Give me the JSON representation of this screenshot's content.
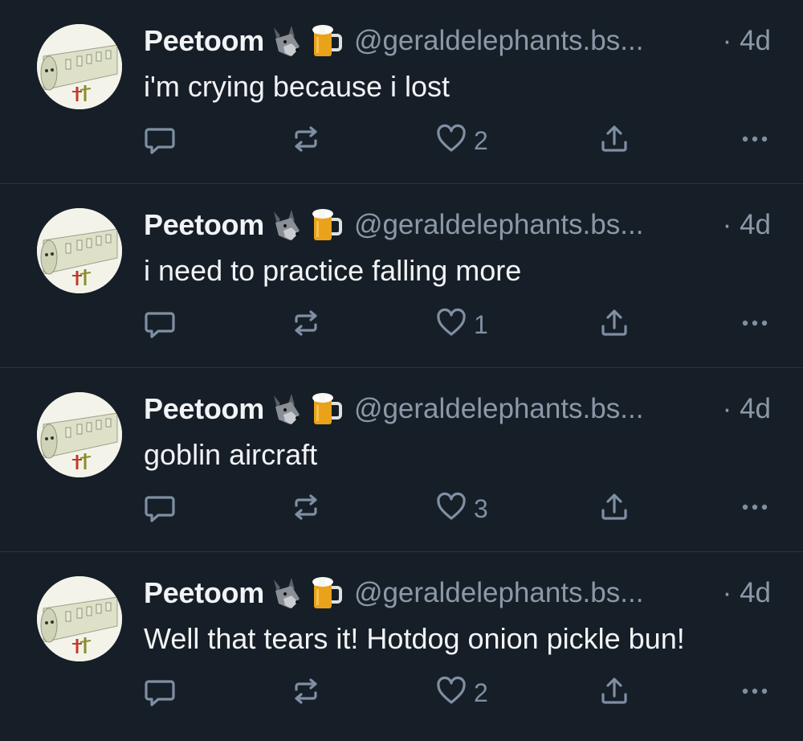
{
  "posts": [
    {
      "author": "Peetoom",
      "handle": "@geraldelephants.bs...",
      "separator": "·",
      "time": "4d",
      "text": "i'm crying because i lost",
      "likes": "2"
    },
    {
      "author": "Peetoom",
      "handle": "@geraldelephants.bs...",
      "separator": "·",
      "time": "4d",
      "text": "i need to practice falling more",
      "likes": "1"
    },
    {
      "author": "Peetoom",
      "handle": "@geraldelephants.bs...",
      "separator": "·",
      "time": "4d",
      "text": "goblin aircraft",
      "likes": "3"
    },
    {
      "author": "Peetoom",
      "handle": "@geraldelephants.bs...",
      "separator": "·",
      "time": "4d",
      "text": "Well that tears it! Hotdog onion pickle bun!",
      "likes": "2"
    }
  ],
  "icons": {
    "author_emoji_1": "wolf-face-icon",
    "author_emoji_2": "beer-mug-icon",
    "reply": "reply-bubble-icon",
    "repost": "repost-arrows-icon",
    "like": "heart-outline-icon",
    "share": "share-upload-icon",
    "more": "more-dots-icon"
  },
  "colors": {
    "background": "#161e27",
    "text": "#f1f3f5",
    "muted": "#8b98a8",
    "icon": "#7f8fa3",
    "divider": "#2a3441"
  }
}
